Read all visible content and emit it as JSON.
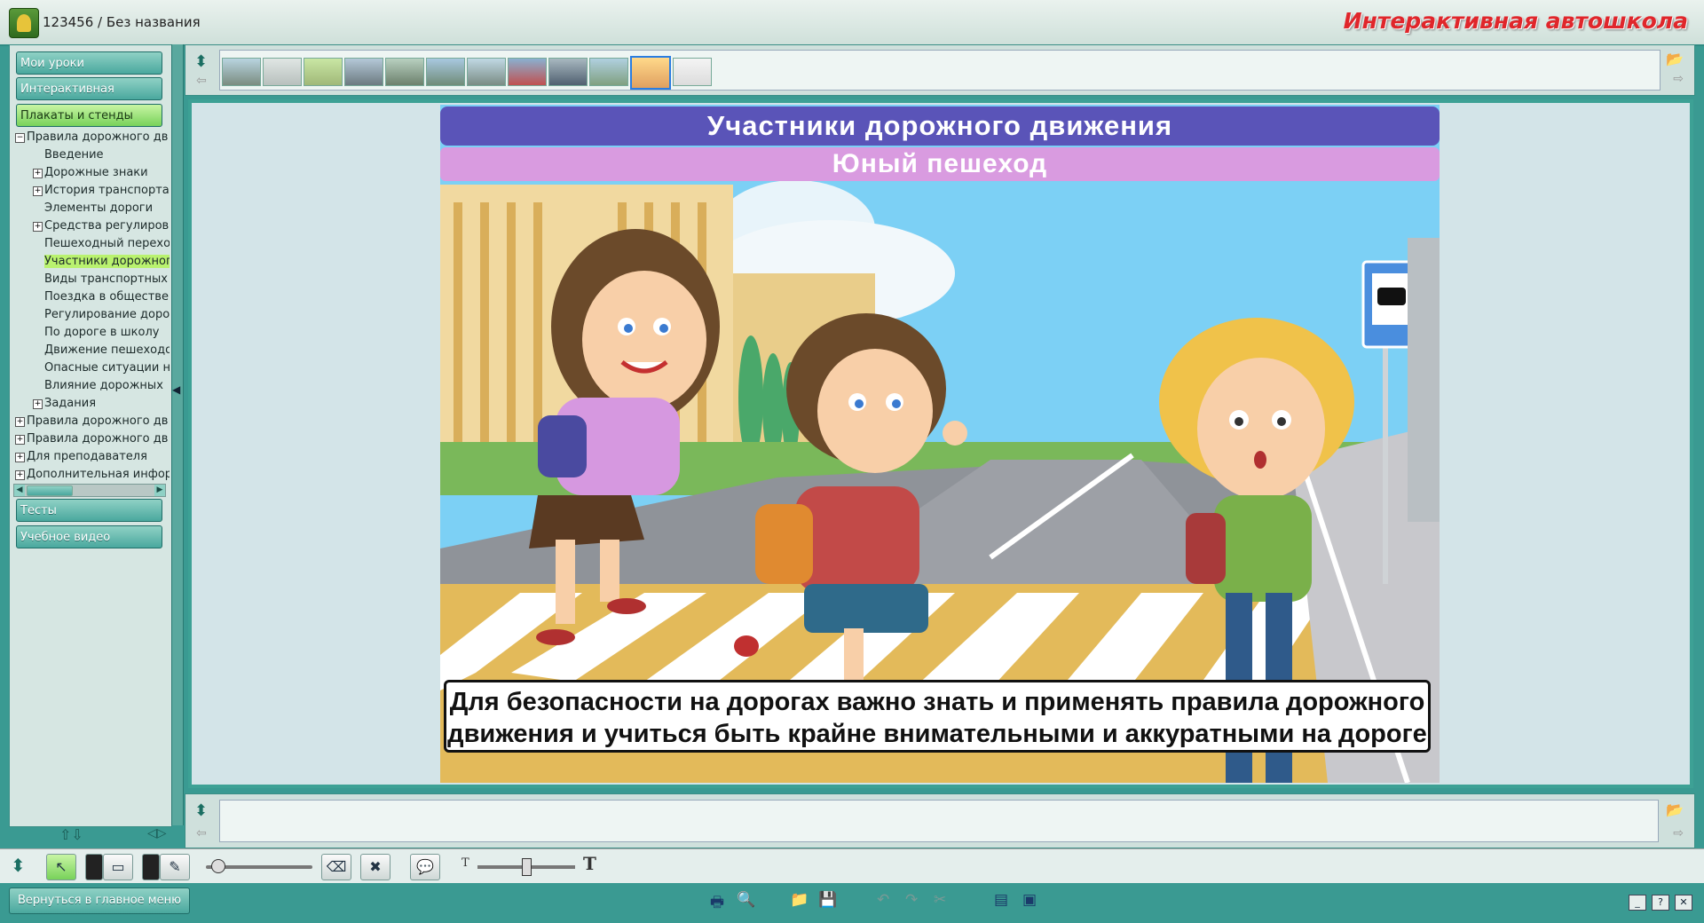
{
  "window": {
    "title": "123456 / Без названия",
    "brand": "Интерактивная автошкола"
  },
  "sidebar": {
    "buttons_top": [
      "Мои уроки",
      "Интерактивная галерея",
      "Плакаты и стенды"
    ],
    "buttons_bottom": [
      "Тесты",
      "Учебное видео"
    ],
    "tree": [
      {
        "label": "Правила дорожного дв",
        "expander": "−",
        "level": 0
      },
      {
        "label": "Введение",
        "expander": "",
        "level": 1
      },
      {
        "label": "Дорожные знаки",
        "expander": "+",
        "level": 1
      },
      {
        "label": "История транспорта",
        "expander": "+",
        "level": 1
      },
      {
        "label": "Элементы дороги",
        "expander": "",
        "level": 1
      },
      {
        "label": "Средства регулиров",
        "expander": "+",
        "level": 1
      },
      {
        "label": "Пешеходный перехо",
        "expander": "",
        "level": 1
      },
      {
        "label": "Участники дорожног",
        "expander": "",
        "level": 1,
        "selected": true
      },
      {
        "label": "Виды транспортных",
        "expander": "",
        "level": 1
      },
      {
        "label": "Поездка в обществе",
        "expander": "",
        "level": 1
      },
      {
        "label": "Регулирование доро",
        "expander": "",
        "level": 1
      },
      {
        "label": "По дороге в школу",
        "expander": "",
        "level": 1
      },
      {
        "label": "Движение пешеходо",
        "expander": "",
        "level": 1
      },
      {
        "label": "Опасные ситуации н",
        "expander": "",
        "level": 1
      },
      {
        "label": "Влияние дорожных",
        "expander": "",
        "level": 1
      },
      {
        "label": "Задания",
        "expander": "+",
        "level": 1
      },
      {
        "label": "Правила дорожного дв",
        "expander": "+",
        "level": 0
      },
      {
        "label": "Правила дорожного дв",
        "expander": "+",
        "level": 0
      },
      {
        "label": "Для преподавателя",
        "expander": "+",
        "level": 0
      },
      {
        "label": "Дополнительная инфор",
        "expander": "+",
        "level": 0
      }
    ]
  },
  "poster": {
    "title": "Участники дорожного движения",
    "subtitle": "Юный пешеход",
    "caption_line1": "Для безопасности на дорогах важно знать и применять правила дорожного",
    "caption_line2": "движения и учиться быть крайне внимательными и аккуратными на дороге"
  },
  "footer": {
    "home_button": "Вернуться в главное меню"
  },
  "colors": {
    "title_band": "#5a54b8",
    "subtitle_band": "#d99be0",
    "brand": "#e0262b",
    "frame": "#3da195"
  }
}
